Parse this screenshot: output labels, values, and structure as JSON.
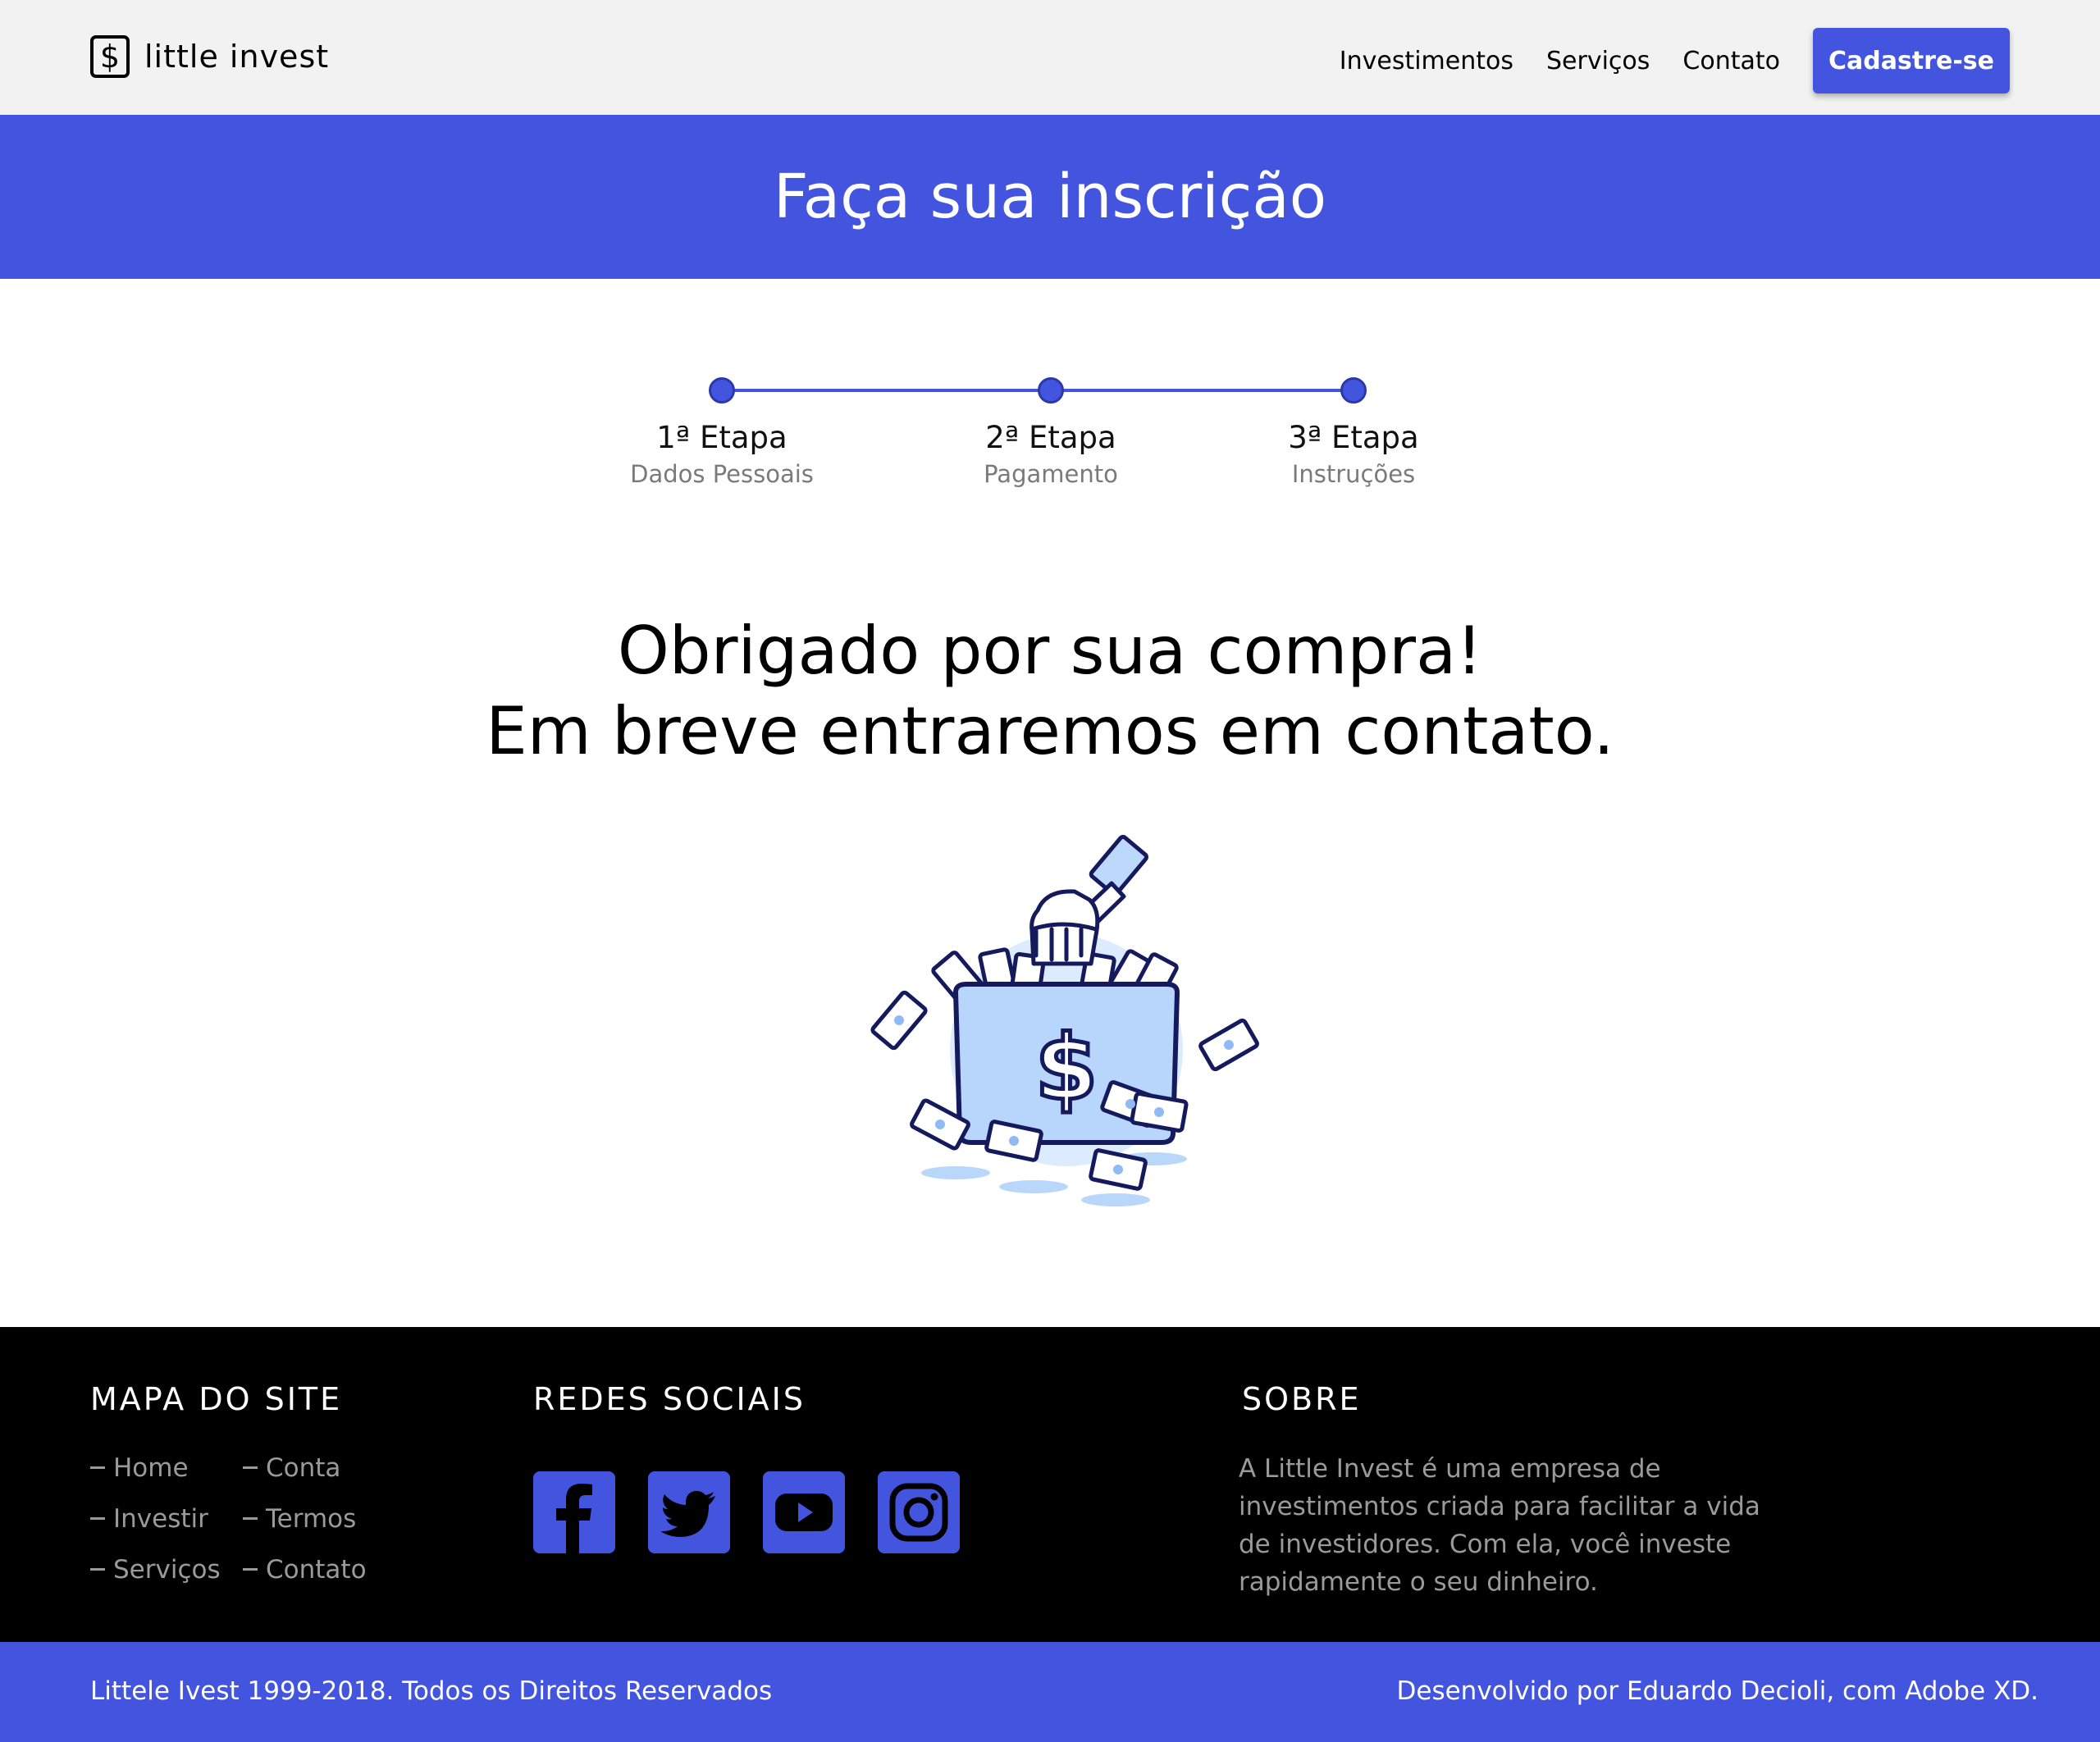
{
  "header": {
    "logo_symbol": "$",
    "logo_text": "little invest",
    "nav": [
      "Investimentos",
      "Serviços",
      "Contato"
    ],
    "cta": "Cadastre-se"
  },
  "banner": {
    "title": "Faça sua inscrição"
  },
  "stepper": {
    "steps": [
      {
        "title": "1ª Etapa",
        "subtitle": "Dados Pessoais"
      },
      {
        "title": "2ª Etapa",
        "subtitle": "Pagamento"
      },
      {
        "title": "3ª Etapa",
        "subtitle": "Instruções"
      }
    ]
  },
  "message": {
    "line1": "Obrigado por sua compra!",
    "line2": "Em breve entraremos em contato."
  },
  "footer": {
    "sitemap": {
      "heading": "MAPA DO SITE",
      "col1": [
        "Home",
        "Investir",
        "Serviços"
      ],
      "col2": [
        "Conta",
        "Termos",
        "Contato"
      ]
    },
    "social": {
      "heading": "REDES SOCIAIS",
      "icons": [
        "facebook-icon",
        "twitter-icon",
        "youtube-icon",
        "instagram-icon"
      ]
    },
    "about": {
      "heading": "SOBRE",
      "text": "A Little Invest é uma empresa de investimentos criada para facilitar a vida de investidores. Com ela, você investe rapidamente o seu dinheiro."
    }
  },
  "bottom": {
    "copyright": "Littele Ivest 1999-2018. Todos os Direitos Reservados",
    "credit": "Desenvolvido por Eduardo Decioli, com Adobe XD."
  },
  "colors": {
    "accent": "#4355de",
    "footer_bg": "#000000",
    "header_bg": "#f2f2f2"
  }
}
